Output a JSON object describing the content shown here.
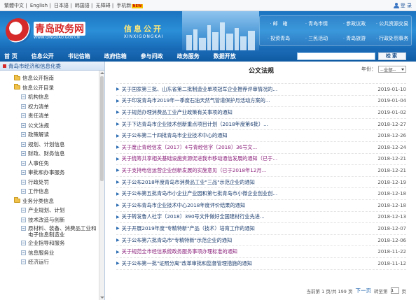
{
  "topbar": {
    "links": [
      "繁體中文",
      "English",
      "日本語",
      "韩国語",
      "无障碍",
      "手机新"
    ],
    "new_badge": "NEW",
    "login": "登 录"
  },
  "header": {
    "logo_cn": "青岛政务网",
    "logo_en": "WWW.QINGDAO.GOV.CN",
    "banner_cn": "信息公开",
    "banner_en": "XINXIGONGKAI",
    "quicklinks": [
      "邮　箱",
      "青岛市情",
      "参政议政",
      "公共资源交易",
      "投资青岛",
      "三民活动",
      "青岛旅游",
      "行政处罚事务"
    ]
  },
  "nav": {
    "items": [
      "首 页",
      "信息公开",
      "书记信箱",
      "政府信箱",
      "参与问政",
      "政务服务",
      "数据开放"
    ],
    "search_placeholder": "",
    "search_button": "检索"
  },
  "sidebar": {
    "title": "青岛市经济和信息化委",
    "tree": [
      {
        "type": "folder",
        "label": "信息公开指南"
      },
      {
        "type": "folder",
        "label": "信息公开目录",
        "children": [
          {
            "label": "机构信息"
          },
          {
            "label": "权力清单"
          },
          {
            "label": "责任清单"
          },
          {
            "label": "公文法规"
          },
          {
            "label": "政策解读"
          },
          {
            "label": "规划、计划信息"
          },
          {
            "label": "财政、财务信息"
          },
          {
            "label": "人事任免"
          },
          {
            "label": "审批和办事服务"
          },
          {
            "label": "行政处罚"
          },
          {
            "label": "工作信息"
          }
        ]
      },
      {
        "type": "folder",
        "label": "业务分类信息",
        "children": [
          {
            "label": "产业规划、计划"
          },
          {
            "label": "技术改造与创新"
          },
          {
            "label": "原材料、装备、消费品工业和电子信息制造业"
          },
          {
            "label": "企业指导和服务"
          },
          {
            "label": "信息服务业"
          },
          {
            "label": "经济运行"
          }
        ]
      }
    ]
  },
  "content": {
    "title": "公文法规",
    "year_label": "年份：",
    "year_selected": "--全部--",
    "articles": [
      {
        "title": "关于国家第三批、山东省第二批制造业单项冠军企业推荐评审情况的...",
        "date": "2019-01-10",
        "visited": false
      },
      {
        "title": "关于印发青岛市2019年一季度石油天然气管道保护月活动方案的...",
        "date": "2019-01-04",
        "visited": false
      },
      {
        "title": "关于规范办理消费品工业产业政策有关事项的通知",
        "date": "2019-01-02",
        "visited": false
      },
      {
        "title": "关于下达青岛市企业技术创新重点项目计划（2018年度第6批）...",
        "date": "2018-12-27",
        "visited": false
      },
      {
        "title": "关于公布第二十四批青岛市企业技术中心的通知",
        "date": "2018-12-26",
        "visited": false
      },
      {
        "title": "关于废止青经信发〔2017〕4号青经信字〔2018〕36号文...",
        "date": "2018-12-24",
        "visited": true
      },
      {
        "title": "关于统筹共享相关基础设施资源促进我市移动通信发展的通知（已于...",
        "date": "2018-12-21",
        "visited": true
      },
      {
        "title": "关于支持电信运营企业创新发展的实施意见（已于2018年12月...",
        "date": "2018-12-21",
        "visited": true
      },
      {
        "title": "关于公布2018年度青岛市消费品工业\"三品\"示范企业的通知",
        "date": "2018-12-19",
        "visited": false
      },
      {
        "title": "关于公布第五批青岛市小企业产业园和第七批青岛市小微企业创业创...",
        "date": "2018-12-18",
        "visited": false
      },
      {
        "title": "关于公布青岛市企业技术中心2018年度评价结果的通知",
        "date": "2018-12-18",
        "visited": false
      },
      {
        "title": "关于转发鲁人社字〔2018〕390号文件做好全国建材行业先进...",
        "date": "2018-12-13",
        "visited": false
      },
      {
        "title": "关于开展2019年度\"专精特新\"产品（技术）培育工作的通知",
        "date": "2018-12-07",
        "visited": false
      },
      {
        "title": "关于公布第六批青岛市\"专精特新\"示范企业的通知",
        "date": "2018-12-06",
        "visited": false
      },
      {
        "title": "关于规范全市经信系统政务服务事项办理标准的通知",
        "date": "2018-11-22",
        "visited": true
      },
      {
        "title": "关于公布第一批\"证照分离\"改革审批和监督管理措施的通知",
        "date": "2018-11-12",
        "visited": false
      }
    ],
    "pager": {
      "status": "当前第 1 页/共 199 页",
      "next": "下一页",
      "goto_label": "转至第",
      "goto_value": "1",
      "goto_unit": "页"
    }
  }
}
